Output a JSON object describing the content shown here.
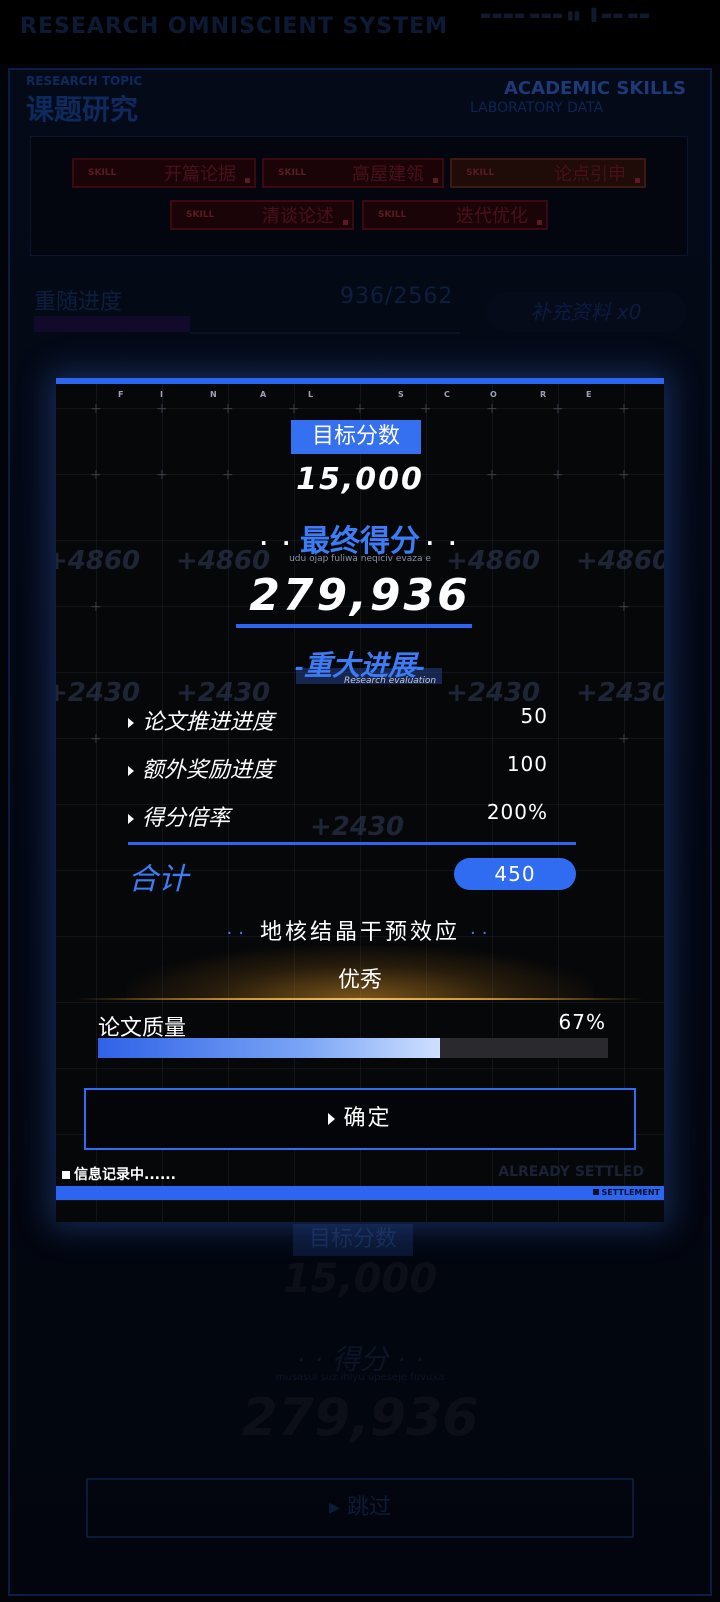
{
  "system_title": "RESEARCH OMNISCIENT SYSTEM",
  "topic": {
    "en": "RESEARCH TOPIC",
    "cn": "课题研究"
  },
  "academic": {
    "title": "ACADEMIC SKILLS",
    "subtitle": "LABORATORY DATA"
  },
  "skill_tag": "SKILL",
  "skills": [
    "开篇论据",
    "高屋建瓴",
    "论点引申",
    "清谈论述",
    "迭代优化"
  ],
  "progress": {
    "label": "重随进度",
    "value": "936/2562",
    "fraction": 0.365
  },
  "supplement": "补充资料 x0",
  "modal": {
    "header_letters": [
      "F",
      "I",
      "N",
      "A",
      "L",
      "S",
      "C",
      "O",
      "R",
      "E"
    ],
    "ghost_values": [
      "+4860",
      "+2430"
    ],
    "target_label": "目标分数",
    "target_value": "15,000",
    "final_label": "最终得分",
    "final_sub": "udu ojap fuliwa neqiciv evaza e",
    "final_value": "279,936",
    "major_label": "重大进展",
    "major_sub": "Research evaluation",
    "stats": [
      {
        "label": "论文推进进度",
        "value": "50"
      },
      {
        "label": "额外奖励进度",
        "value": "100"
      },
      {
        "label": "得分倍率",
        "value": "200%"
      }
    ],
    "total_label": "合计",
    "total_value": "450",
    "effect_label": "地核结晶干预效应",
    "grade": "优秀",
    "quality_label": "论文质量",
    "quality_value": "67%",
    "quality_fraction": 0.67,
    "confirm_label": "确定",
    "recording": "信息记录中......",
    "settled": "ALREADY SETTLED",
    "settlement": "SETTLEMENT"
  },
  "background": {
    "target_label": "目标分数",
    "target_value": "15,000",
    "score_label": "得分",
    "score_sub": "musasul suz ihiyu upeseje fuvuxa",
    "score_value": "279,936",
    "skip_label": "跳过"
  },
  "colors": {
    "accent": "#2c66f0",
    "accent_text": "#3d7cf5",
    "gold": "#d39a2a"
  }
}
